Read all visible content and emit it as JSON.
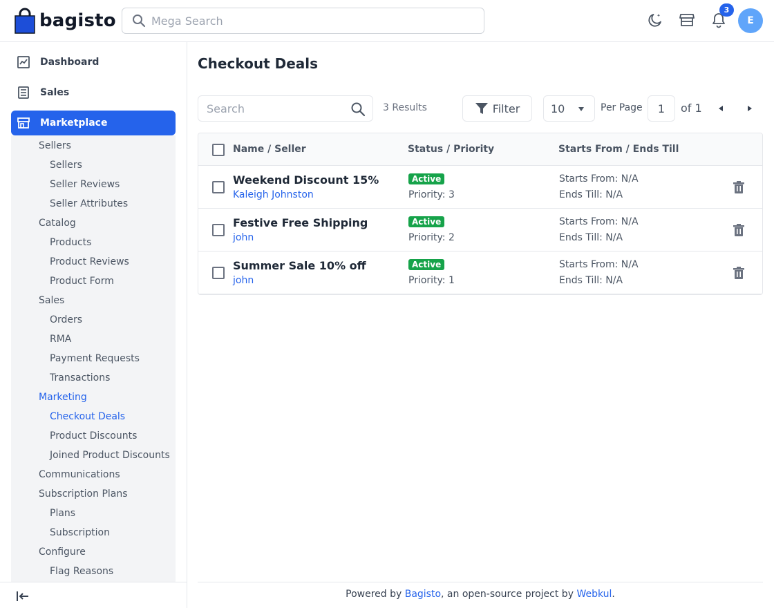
{
  "header": {
    "logo_text": "bagisto",
    "search_placeholder": "Mega Search",
    "notification_count": "3",
    "avatar_initial": "E"
  },
  "sidebar": {
    "top_items": [
      {
        "label": "Dashboard",
        "icon": "dashboard-icon"
      },
      {
        "label": "Sales",
        "icon": "sales-icon"
      },
      {
        "label": "Marketplace",
        "icon": "marketplace-icon",
        "active": true
      }
    ],
    "marketplace_menu": [
      {
        "label": "Sellers",
        "level": 1
      },
      {
        "label": "Sellers",
        "level": 2
      },
      {
        "label": "Seller Reviews",
        "level": 2
      },
      {
        "label": "Seller Attributes",
        "level": 2
      },
      {
        "label": "Catalog",
        "level": 1
      },
      {
        "label": "Products",
        "level": 2
      },
      {
        "label": "Product Reviews",
        "level": 2
      },
      {
        "label": "Product Form",
        "level": 2
      },
      {
        "label": "Sales",
        "level": 1
      },
      {
        "label": "Orders",
        "level": 2
      },
      {
        "label": "RMA",
        "level": 2
      },
      {
        "label": "Payment Requests",
        "level": 2
      },
      {
        "label": "Transactions",
        "level": 2
      },
      {
        "label": "Marketing",
        "level": 1,
        "active": true
      },
      {
        "label": "Checkout Deals",
        "level": 2,
        "active": true
      },
      {
        "label": "Product Discounts",
        "level": 2
      },
      {
        "label": "Joined Product Discounts",
        "level": 2
      },
      {
        "label": "Communications",
        "level": 1
      },
      {
        "label": "Subscription Plans",
        "level": 1
      },
      {
        "label": "Plans",
        "level": 2
      },
      {
        "label": "Subscription",
        "level": 2
      },
      {
        "label": "Configure",
        "level": 1
      },
      {
        "label": "Flag Reasons",
        "level": 2
      }
    ]
  },
  "main": {
    "title": "Checkout Deals",
    "search_placeholder": "Search",
    "results_text": "3 Results",
    "filter_label": "Filter",
    "per_page_value": "10",
    "per_page_label": "Per Page",
    "current_page": "1",
    "page_of": "of 1",
    "columns": [
      "Name / Seller",
      "Status / Priority",
      "Starts From / Ends Till"
    ],
    "rows": [
      {
        "name": "Weekend Discount 15%",
        "seller": "Kaleigh Johnston",
        "status": "Active",
        "priority": "Priority: 3",
        "starts_from": "Starts From: N/A",
        "ends_till": "Ends Till: N/A"
      },
      {
        "name": "Festive Free Shipping",
        "seller": "john",
        "status": "Active",
        "priority": "Priority: 2",
        "starts_from": "Starts From: N/A",
        "ends_till": "Ends Till: N/A"
      },
      {
        "name": "Summer Sale 10% off",
        "seller": "john",
        "status": "Active",
        "priority": "Priority: 1",
        "starts_from": "Starts From: N/A",
        "ends_till": "Ends Till: N/A"
      }
    ]
  },
  "footer": {
    "prefix": "Powered by ",
    "link1": "Bagisto",
    "middle": ", an open-source project by ",
    "link2": "Webkul",
    "suffix": "."
  },
  "colors": {
    "accent": "#2563eb",
    "status_active": "#16a34a",
    "submenu_bg": "#f3f4f6"
  }
}
